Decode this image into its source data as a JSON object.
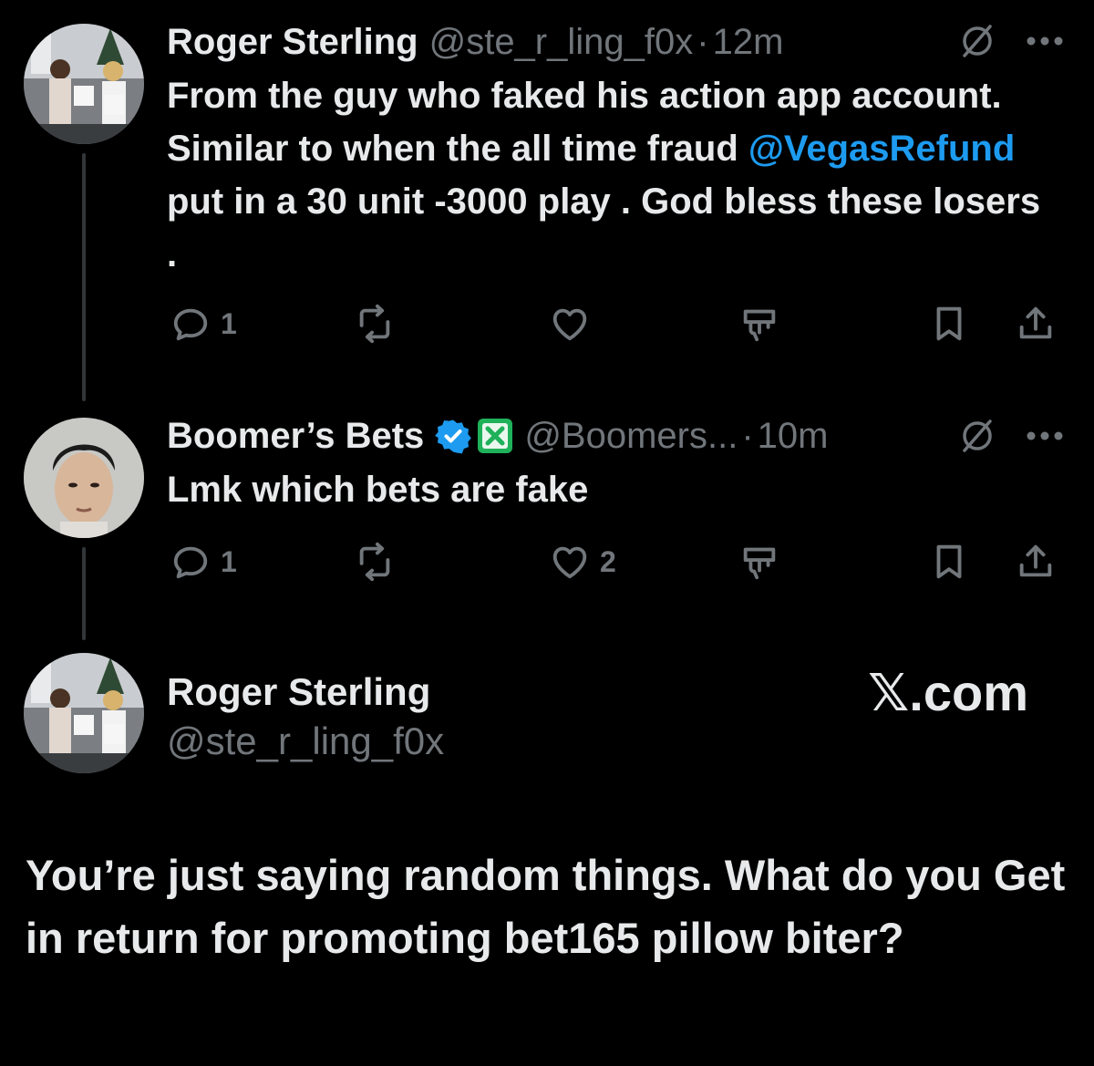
{
  "tweets": [
    {
      "author_name": "Roger Sterling",
      "handle": "@ste_r_ling_f0x",
      "separator": "·",
      "time": "12m",
      "text_parts": [
        "From the guy who faked his action app account. Similar to when the all time fraud ",
        "@VegasRefund",
        " put in a 30 unit -3000 play . God bless these losers ."
      ],
      "actions": {
        "reply_count": "1",
        "repost_count": "",
        "like_count": "",
        "views_count": ""
      }
    },
    {
      "author_name": "Boomer’s Bets",
      "handle": "@Boomers...",
      "separator": "·",
      "time": "10m",
      "text": "Lmk which bets are fake",
      "actions": {
        "reply_count": "1",
        "repost_count": "",
        "like_count": "2",
        "views_count": ""
      }
    }
  ],
  "quoted": {
    "author_name": "Roger Sterling",
    "handle": "@ste_r_ling_f0x",
    "site": "𝕏.com",
    "text": "You’re just saying random things. What do you Get in return for promoting bet165 pillow biter?"
  },
  "colors": {
    "background": "#000000",
    "text": "#e7e9ea",
    "muted": "#71767b",
    "link": "#1d9bf0",
    "verified": "#1d9bf0",
    "affiliate": "#1fb15a",
    "thread_line": "#333639"
  },
  "icons": {
    "reply": "reply-icon",
    "repost": "repost-icon",
    "like": "heart-icon",
    "views": "views-icon",
    "bookmark": "bookmark-icon",
    "share": "share-icon",
    "grok": "grok-icon",
    "more": "more-icon",
    "verified": "verified-badge-icon",
    "affiliate": "affiliate-badge-icon"
  }
}
